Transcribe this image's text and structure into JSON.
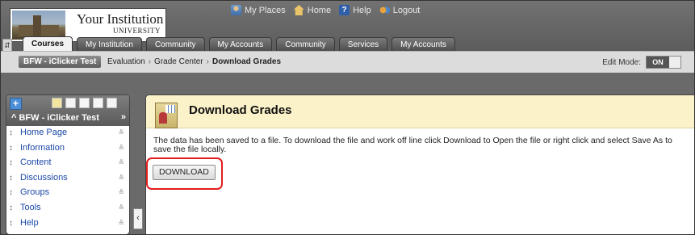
{
  "header": {
    "logo_title": "Your Institution",
    "logo_subtitle": "UNIVERSITY",
    "top_links": [
      "My Places",
      "Home",
      "Help",
      "Logout"
    ]
  },
  "tabs": [
    "Courses",
    "My Institution",
    "Community",
    "My Accounts",
    "Community",
    "Services",
    "My Accounts"
  ],
  "active_tab": "Courses",
  "breadcrumb": {
    "course": "BFW - iClicker Test",
    "items": [
      "Evaluation",
      "Grade Center",
      "Download Grades"
    ]
  },
  "edit_mode": {
    "label": "Edit Mode:",
    "state": "ON"
  },
  "course_menu": {
    "title": "BFW - iClicker Test",
    "collapse_glyph": "»",
    "items": [
      "Home Page",
      "Information",
      "Content",
      "Discussions",
      "Groups",
      "Tools",
      "Help"
    ]
  },
  "content": {
    "title": "Download Grades",
    "message": "The data has been saved to a file. To download the file and work off line click Download to Open the file or right click and select Save As to save the file locally.",
    "download_button": "DOWNLOAD"
  },
  "colors": {
    "highlight": "#e21c1c",
    "link": "#1b48a8",
    "header_bg": "#fbf2c9"
  }
}
